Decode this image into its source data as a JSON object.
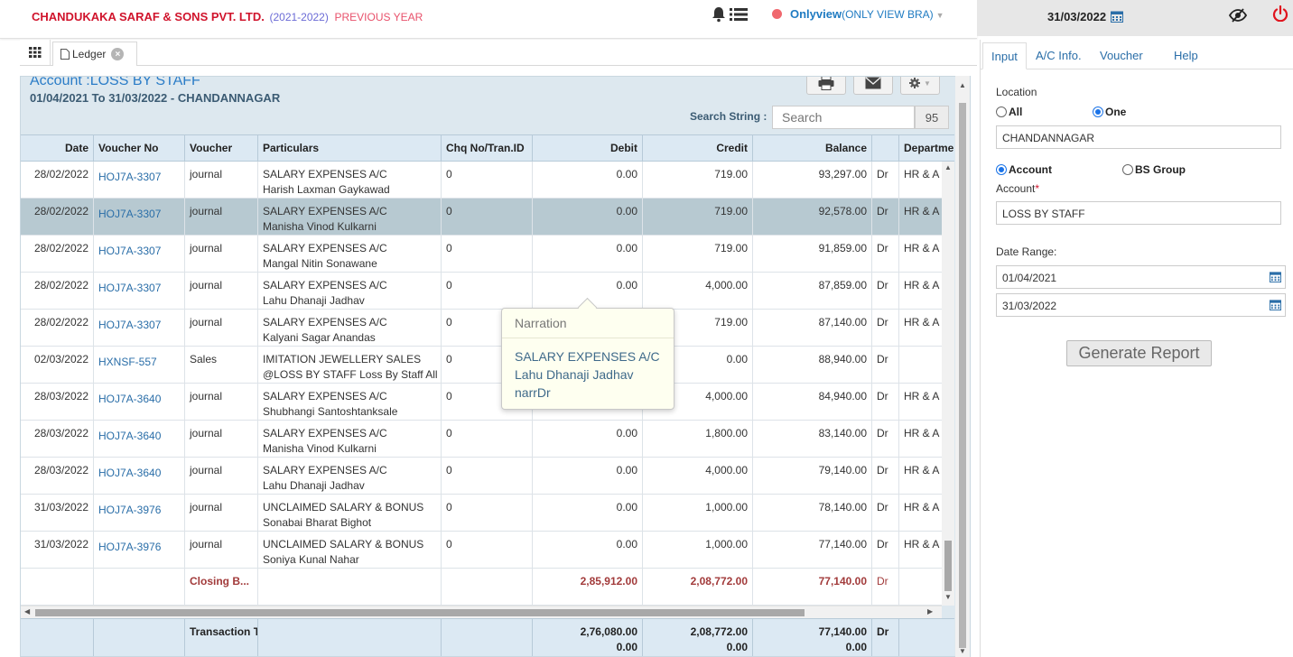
{
  "header": {
    "company": "CHANDUKAKA SARAF & SONS PVT. LTD.",
    "year": "(2021-2022)",
    "year_note": "PREVIOUS YEAR",
    "user": "Onlyview",
    "user_mode": "(ONLY VIEW BRA)",
    "date": "31/03/2022"
  },
  "tabs": {
    "ledger": "Ledger"
  },
  "account": {
    "title": "Account :LOSS BY STAFF",
    "range": "01/04/2021 To 31/03/2022 - CHANDANNAGAR"
  },
  "search": {
    "label": "Search String :",
    "placeholder": "Search",
    "count": "95"
  },
  "columns": [
    "Date",
    "Voucher No",
    "Voucher",
    "Particulars",
    "Chq No/Tran.ID",
    "Debit",
    "Credit",
    "Balance",
    "",
    "Departme"
  ],
  "rows": [
    {
      "date": "28/02/2022",
      "vno": "HOJ7A-3307",
      "voucher": "journal",
      "p1": "SALARY EXPENSES A/C",
      "p2": "Harish Laxman Gaykawad",
      "chq": "0",
      "debit": "0.00",
      "credit": "719.00",
      "balance": "93,297.00",
      "drcr": "Dr",
      "dept": "HR & A"
    },
    {
      "date": "28/02/2022",
      "vno": "HOJ7A-3307",
      "voucher": "journal",
      "p1": "SALARY EXPENSES A/C",
      "p2": "Manisha Vinod Kulkarni",
      "chq": "0",
      "debit": "0.00",
      "credit": "719.00",
      "balance": "92,578.00",
      "drcr": "Dr",
      "dept": "HR & A"
    },
    {
      "date": "28/02/2022",
      "vno": "HOJ7A-3307",
      "voucher": "journal",
      "p1": "SALARY EXPENSES A/C",
      "p2": "Mangal Nitin Sonawane",
      "chq": "0",
      "debit": "0.00",
      "credit": "719.00",
      "balance": "91,859.00",
      "drcr": "Dr",
      "dept": "HR & A"
    },
    {
      "date": "28/02/2022",
      "vno": "HOJ7A-3307",
      "voucher": "journal",
      "p1": "SALARY EXPENSES A/C",
      "p2": "Lahu Dhanaji Jadhav",
      "chq": "0",
      "debit": "0.00",
      "credit": "4,000.00",
      "balance": "87,859.00",
      "drcr": "Dr",
      "dept": "HR & A"
    },
    {
      "date": "28/02/2022",
      "vno": "HOJ7A-3307",
      "voucher": "journal",
      "p1": "SALARY EXPENSES A/C",
      "p2": "Kalyani Sagar Anandas",
      "chq": "0",
      "debit": "",
      "credit": "719.00",
      "balance": "87,140.00",
      "drcr": "Dr",
      "dept": "HR & A"
    },
    {
      "date": "02/03/2022",
      "vno": "HXNSF-557",
      "voucher": "Sales",
      "p1": "IMITATION JEWELLERY SALES",
      "p2": "@LOSS BY STAFF Loss By Staff All",
      "chq": "0",
      "debit": "",
      "credit": "0.00",
      "balance": "88,940.00",
      "drcr": "Dr",
      "dept": ""
    },
    {
      "date": "28/03/2022",
      "vno": "HOJ7A-3640",
      "voucher": "journal",
      "p1": "SALARY EXPENSES A/C",
      "p2": "Shubhangi Santoshtanksale",
      "chq": "0",
      "debit": "",
      "credit": "4,000.00",
      "balance": "84,940.00",
      "drcr": "Dr",
      "dept": "HR & A"
    },
    {
      "date": "28/03/2022",
      "vno": "HOJ7A-3640",
      "voucher": "journal",
      "p1": "SALARY EXPENSES A/C",
      "p2": "Manisha Vinod Kulkarni",
      "chq": "0",
      "debit": "0.00",
      "credit": "1,800.00",
      "balance": "83,140.00",
      "drcr": "Dr",
      "dept": "HR & A"
    },
    {
      "date": "28/03/2022",
      "vno": "HOJ7A-3640",
      "voucher": "journal",
      "p1": "SALARY EXPENSES A/C",
      "p2": "Lahu Dhanaji Jadhav",
      "chq": "0",
      "debit": "0.00",
      "credit": "4,000.00",
      "balance": "79,140.00",
      "drcr": "Dr",
      "dept": "HR & A"
    },
    {
      "date": "31/03/2022",
      "vno": "HOJ7A-3976",
      "voucher": "journal",
      "p1": "UNCLAIMED SALARY & BONUS",
      "p2": "Sonabai Bharat Bighot",
      "chq": "0",
      "debit": "0.00",
      "credit": "1,000.00",
      "balance": "78,140.00",
      "drcr": "Dr",
      "dept": "HR & A"
    },
    {
      "date": "31/03/2022",
      "vno": "HOJ7A-3976",
      "voucher": "journal",
      "p1": "UNCLAIMED SALARY & BONUS",
      "p2": "Soniya Kunal Nahar",
      "chq": "0",
      "debit": "0.00",
      "credit": "1,000.00",
      "balance": "77,140.00",
      "drcr": "Dr",
      "dept": "HR & A"
    }
  ],
  "closing": {
    "label": "Closing B...",
    "debit": "2,85,912.00",
    "credit": "2,08,772.00",
    "balance": "77,140.00",
    "drcr": "Dr"
  },
  "footer": {
    "label": "Transaction T",
    "debit": "2,76,080.00",
    "debit2": "0.00",
    "credit": "2,08,772.00",
    "credit2": "0.00",
    "balance": "77,140.00",
    "balance2": "0.00",
    "drcr": "Dr"
  },
  "narration": {
    "title": "Narration",
    "line1": "SALARY EXPENSES A/C",
    "line2": "Lahu Dhanaji Jadhav",
    "line3": "narrDr"
  },
  "panel": {
    "tabs": [
      "Input",
      "A/C Info.",
      "Voucher",
      "Help"
    ],
    "location_label": "Location",
    "opt_all": "All",
    "opt_one": "One",
    "location_value": "CHANDANNAGAR",
    "opt_account": "Account",
    "opt_bs_group": "BS Group",
    "account_label": "Account",
    "account_value": "LOSS BY STAFF",
    "date_range_label": "Date Range:",
    "date_from": "01/04/2021",
    "date_to": "31/03/2022",
    "generate": "Generate Report"
  },
  "colors": {
    "brand_red": "#d0142c",
    "link_blue": "#2a6ea8",
    "selected_row": "#b7c9d1",
    "header_bg": "#dce9f3"
  }
}
